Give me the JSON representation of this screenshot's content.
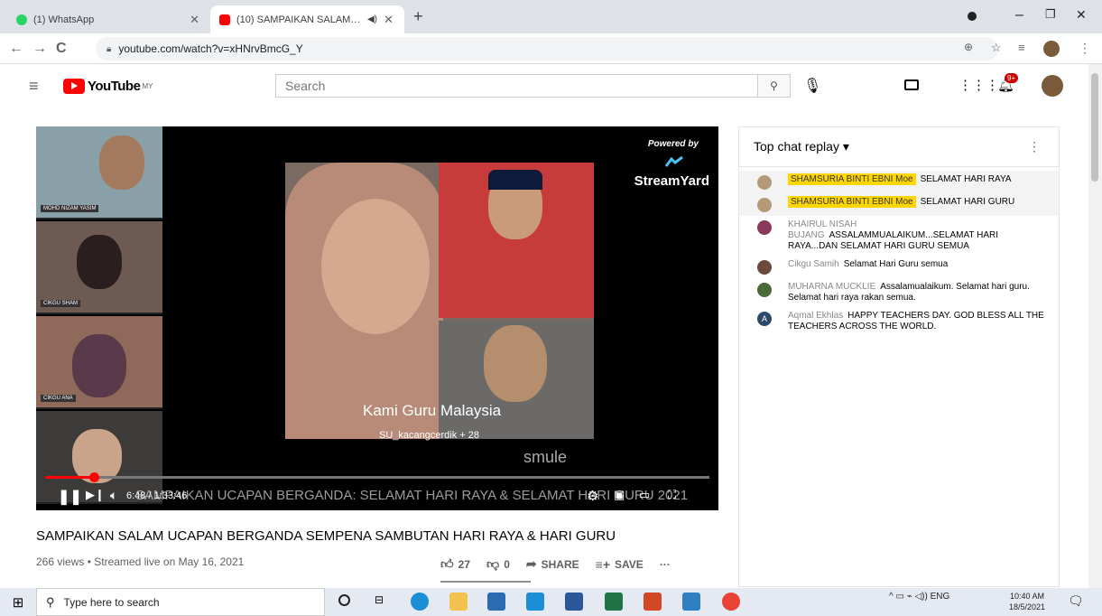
{
  "browser": {
    "tabs": [
      {
        "title": "(1) WhatsApp",
        "active": false,
        "color": "#25d366"
      },
      {
        "title": "(10) SAMPAIKAN SALAM UC",
        "active": true,
        "color": "#ff0000"
      }
    ],
    "new_tab": "+",
    "url": "youtube.com/watch?v=xHNrvBmcG_Y",
    "window_controls": {
      "minimize": "–",
      "maximize": "❐",
      "close": "✕"
    }
  },
  "youtube": {
    "logo_text": "YouTube",
    "logo_region": "MY",
    "search_placeholder": "Search",
    "notification_count": "9+"
  },
  "player": {
    "participants": [
      {
        "name": "MOHD NIZAM YASIM",
        "bg": "#8aa0a8"
      },
      {
        "name": "CIKGU SHAM",
        "bg": "#6d5a52"
      },
      {
        "name": "CIKGU ANA",
        "bg": "#8f6a5a"
      },
      {
        "name": "",
        "bg": "#3d3b3a"
      }
    ],
    "powered_by": "Powered by",
    "streamyard": "StreamYard",
    "caption_title": "Kami Guru Malaysia",
    "caption_singer": "SU_kacangcerdik + 28",
    "smule": "smule",
    "overlay_title": "SAMPAIKAN UCAPAN BERGANDA: SELAMAT HARI RAYA & SELAMAT HARI GURU 2021",
    "time": "6:48 / 1:33:46",
    "progress": 0.073
  },
  "video": {
    "title": "SAMPAIKAN SALAM UCAPAN BERGANDA SEMPENA SAMBUTAN HARI RAYA & HARI GURU",
    "meta": "266 views • Streamed live on May 16, 2021",
    "likes": "27",
    "dislikes": "0",
    "share": "SHARE",
    "save": "SAVE",
    "more": "···"
  },
  "chat": {
    "header": "Top chat replay ▾",
    "messages": [
      {
        "author": "SHAMSURIA BINTI EBNI Moe",
        "text": "SELAMAT HARI RAYA",
        "highlight": true,
        "avatar": "#b59a7a",
        "initial": ""
      },
      {
        "author": "SHAMSURIA BINTI EBNI Moe",
        "text": "SELAMAT HARI GURU",
        "highlight": true,
        "avatar": "#b59a7a",
        "initial": ""
      },
      {
        "author": "KHAIRUL NISAH BUJANG",
        "text": "ASSALAMMUALAIKUM...SELAMAT HARI RAYA...DAN SELAMAT HARI GURU SEMUA",
        "highlight": false,
        "avatar": "#8a3a5a",
        "initial": ""
      },
      {
        "author": "Cikgu Samih",
        "text": "Selamat Hari Guru semua",
        "highlight": false,
        "avatar": "#6a4a3a",
        "initial": ""
      },
      {
        "author": "MUHARNA MUCKLIE",
        "text": "Assalamualaikum. Selamat hari guru. Selamat hari raya rakan semua.",
        "highlight": false,
        "avatar": "#4a6a3a",
        "initial": ""
      },
      {
        "author": "Aqmal Ekhlas",
        "text": "HAPPY TEACHERS DAY. GOD BLESS ALL THE TEACHERS ACROSS THE WORLD.",
        "highlight": false,
        "avatar": "#2b4a6b",
        "initial": "A"
      }
    ]
  },
  "taskbar": {
    "search_placeholder": "Type here to search",
    "tray": "^  ▭  ⌁  ◁))  ENG",
    "time": "10:40 AM",
    "date": "18/5/2021"
  }
}
